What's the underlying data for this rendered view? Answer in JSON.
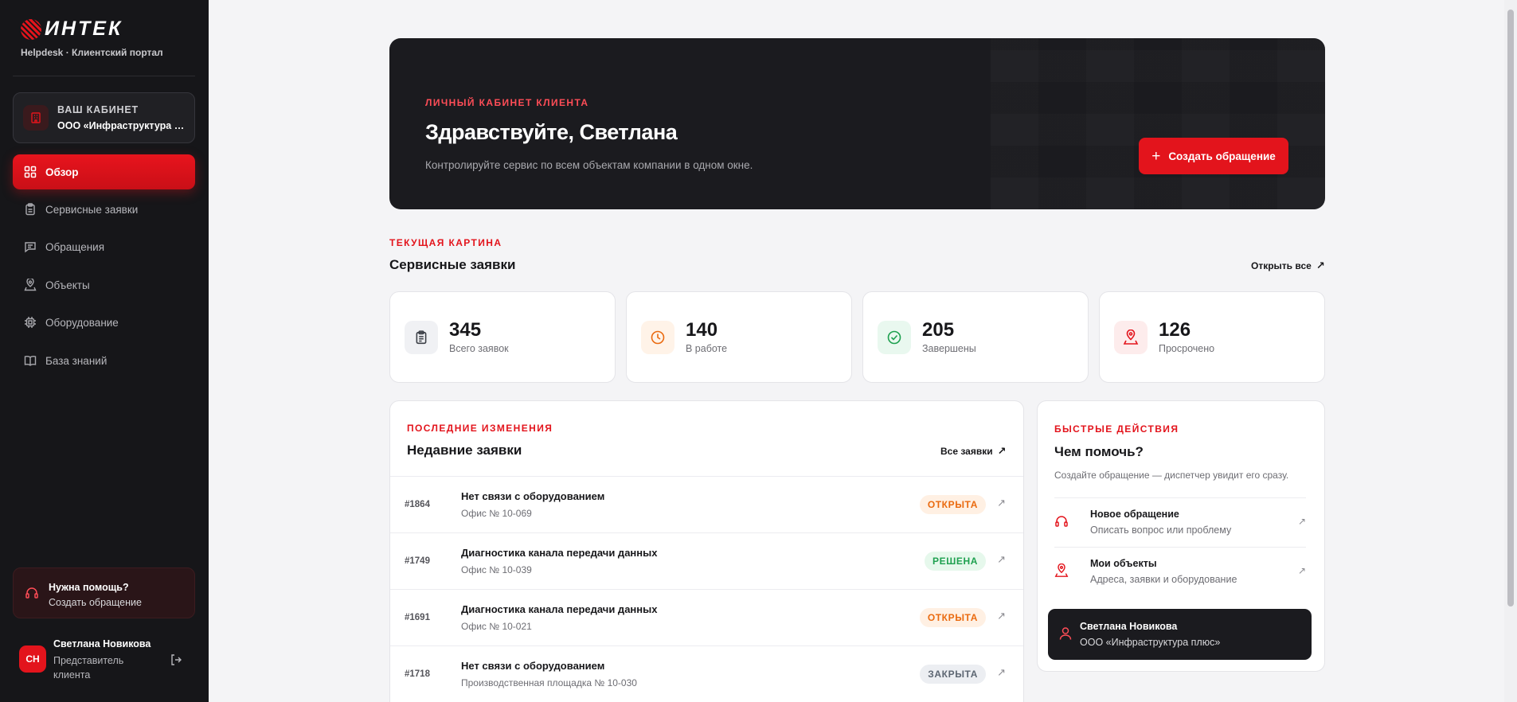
{
  "brand": {
    "logo_text": "ИНТЕК",
    "subtitle": "Helpdesk · Клиентский портал",
    "accent": "#e3141c"
  },
  "sidebar": {
    "cabinet": {
      "title": "ВАШ КАБИНЕТ",
      "org": "ООО «Инфраструктура плюс»",
      "icon": "building-icon"
    },
    "items": [
      {
        "label": "Обзор",
        "icon": "grid-icon",
        "active": true
      },
      {
        "label": "Сервисные заявки",
        "icon": "clipboard-icon"
      },
      {
        "label": "Обращения",
        "icon": "message-icon"
      },
      {
        "label": "Объекты",
        "icon": "map-pin-icon"
      },
      {
        "label": "Оборудование",
        "icon": "chip-icon"
      },
      {
        "label": "База знаний",
        "icon": "book-icon"
      }
    ],
    "help": {
      "title": "Нужна помощь?",
      "subtitle": "Создать обращение",
      "icon": "headset-icon"
    },
    "user": {
      "initials": "СН",
      "name": "Светлана Новикова",
      "role": "Представитель клиента",
      "logout_icon": "logout-icon"
    }
  },
  "hero": {
    "eyebrow": "ЛИЧНЫЙ КАБИНЕТ КЛИЕНТА",
    "title": "Здравствуйте, Светлана",
    "subtitle": "Контролируйте сервис по всем объектам компании в одном окне.",
    "button_label": "Создать обращение",
    "button_icon": "+"
  },
  "service": {
    "eyebrow": "ТЕКУЩАЯ КАРТИНА",
    "title": "Сервисные заявки",
    "link_label": "Открыть все",
    "stats": [
      {
        "value": "345",
        "label": "Всего заявок",
        "icon": "clipboard-icon",
        "color": "#5d6672"
      },
      {
        "value": "140",
        "label": "В работе",
        "icon": "clock-icon",
        "color": "#ea6a0f"
      },
      {
        "value": "205",
        "label": "Завершены",
        "icon": "check-circle-icon",
        "color": "#1ea04f"
      },
      {
        "value": "126",
        "label": "Просрочено",
        "icon": "alert-pin-icon",
        "color": "#e3141c"
      }
    ]
  },
  "recent": {
    "eyebrow": "ПОСЛЕДНИЕ ИЗМЕНЕНИЯ",
    "title": "Недавние заявки",
    "link_label": "Все заявки",
    "rows": [
      {
        "id": "#1864",
        "title": "Нет связи с оборудованием",
        "location": "Офис № 10-069",
        "status": "ОТКРЫТА",
        "status_kind": "open"
      },
      {
        "id": "#1749",
        "title": "Диагностика канала передачи данных",
        "location": "Офис № 10-039",
        "status": "РЕШЕНА",
        "status_kind": "solved"
      },
      {
        "id": "#1691",
        "title": "Диагностика канала передачи данных",
        "location": "Офис № 10-021",
        "status": "ОТКРЫТА",
        "status_kind": "open"
      },
      {
        "id": "#1718",
        "title": "Нет связи с оборудованием",
        "location": "Производственная площадка № 10-030",
        "status": "ЗАКРЫТА",
        "status_kind": "closed"
      }
    ]
  },
  "quick": {
    "eyebrow": "БЫСТРЫЕ ДЕЙСТВИЯ",
    "title": "Чем помочь?",
    "subtitle": "Создайте обращение — диспетчер увидит его сразу.",
    "actions": [
      {
        "title": "Новое обращение",
        "subtitle": "Описать вопрос или проблему",
        "icon": "headset-icon"
      },
      {
        "title": "Мои объекты",
        "subtitle": "Адреса, заявки и оборудование",
        "icon": "map-pin-icon"
      }
    ],
    "profile": {
      "name": "Светлана Новикова",
      "org": "ООО «Инфраструктура плюс»",
      "icon": "user-icon"
    }
  }
}
